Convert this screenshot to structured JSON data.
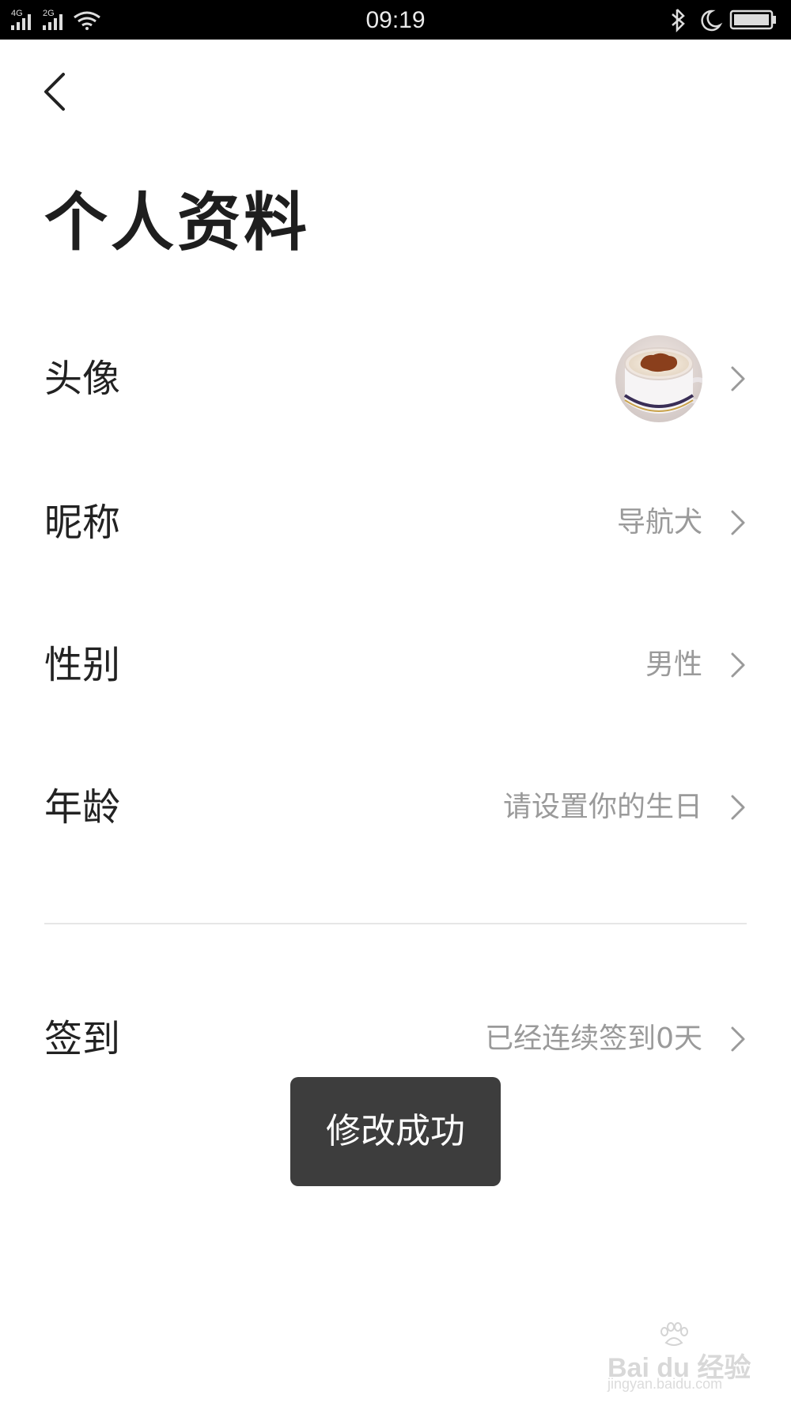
{
  "status_bar": {
    "time": "09:19",
    "network_1": "4G",
    "network_2": "2G",
    "icons": [
      "signal-icon",
      "signal-icon",
      "wifi-icon",
      "bluetooth-icon",
      "moon-icon",
      "battery-icon"
    ]
  },
  "header": {
    "back_icon": "chevron-left-icon",
    "title": "个人资料"
  },
  "rows": [
    {
      "label": "头像",
      "type": "avatar",
      "chevron_icon": "chevron-right-icon"
    },
    {
      "label": "昵称",
      "value": "导航犬",
      "chevron_icon": "chevron-right-icon"
    },
    {
      "label": "性别",
      "value": "男性",
      "chevron_icon": "chevron-right-icon"
    },
    {
      "label": "年龄",
      "value": "请设置你的生日",
      "chevron_icon": "chevron-right-icon"
    },
    {
      "label": "签到",
      "value": "已经连续签到0天",
      "chevron_icon": "chevron-right-icon"
    }
  ],
  "toast": {
    "message": "修改成功"
  },
  "watermark": {
    "brand": "Bai du 经验",
    "url": "jingyan.baidu.com"
  },
  "colors": {
    "status_bar_bg": "#000000",
    "title_text": "#1e1e1e",
    "value_text": "#9a9a9a",
    "toast_bg": "#3d3d3d",
    "divider": "#e6e6e6"
  }
}
